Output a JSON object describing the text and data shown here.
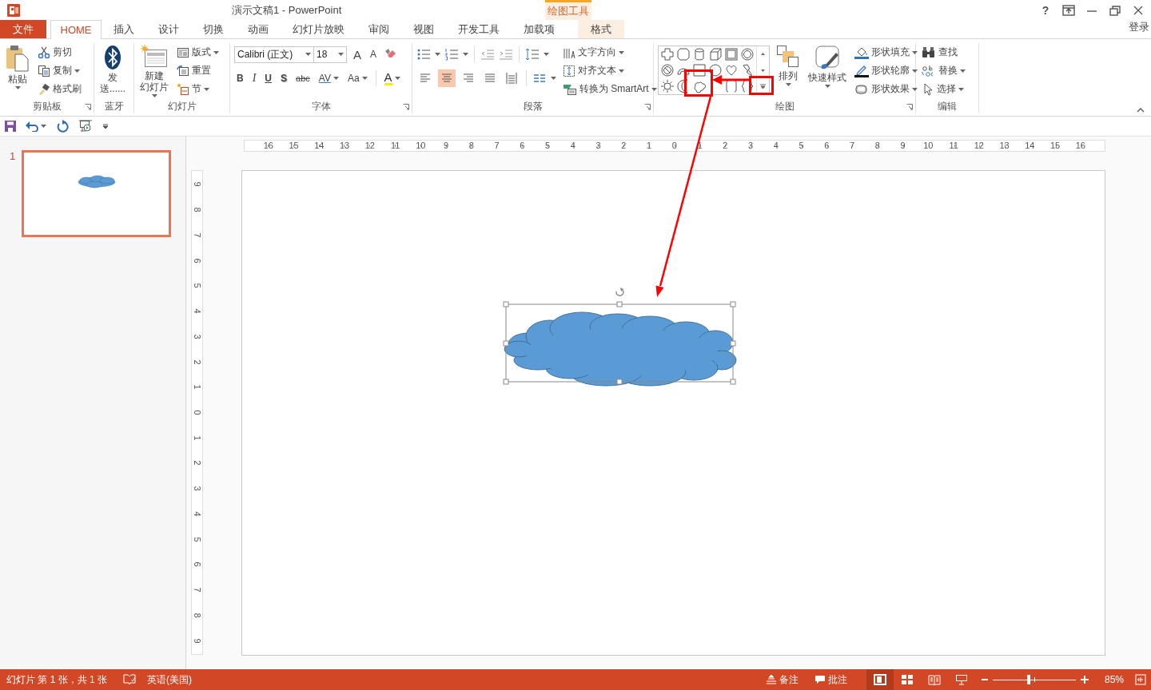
{
  "window": {
    "title": "演示文稿1 - PowerPoint",
    "help": "?",
    "context_group": "绘图工具",
    "sign_in": "登录"
  },
  "tabs": [
    {
      "label": "文件",
      "kind": "file",
      "selected": false
    },
    {
      "label": "HOME",
      "kind": "normal",
      "selected": true
    },
    {
      "label": "插入",
      "kind": "normal",
      "selected": false
    },
    {
      "label": "设计",
      "kind": "normal",
      "selected": false
    },
    {
      "label": "切换",
      "kind": "normal",
      "selected": false
    },
    {
      "label": "动画",
      "kind": "normal",
      "selected": false
    },
    {
      "label": "幻灯片放映",
      "kind": "normal",
      "selected": false
    },
    {
      "label": "审阅",
      "kind": "normal",
      "selected": false
    },
    {
      "label": "视图",
      "kind": "normal",
      "selected": false
    },
    {
      "label": "开发工具",
      "kind": "normal",
      "selected": false
    },
    {
      "label": "加载项",
      "kind": "normal",
      "selected": false
    },
    {
      "label": "格式",
      "kind": "contextual",
      "selected": false
    }
  ],
  "ribbon": {
    "groups": [
      {
        "kind": "clipboard",
        "label": "剪贴板",
        "big": "粘贴",
        "items": [
          {
            "label": "剪切",
            "kind": "cut"
          },
          {
            "label": "复制",
            "kind": "copy"
          },
          {
            "label": "格式刷",
            "kind": "painter"
          }
        ]
      },
      {
        "kind": "bluetooth",
        "label": "蓝牙",
        "big": [
          "发",
          "送......"
        ]
      },
      {
        "kind": "slides",
        "label": "幻灯片",
        "big": [
          "新建",
          "幻灯片"
        ],
        "items": [
          {
            "label": "版式",
            "kind": "layout"
          },
          {
            "label": "重置",
            "kind": "reset"
          },
          {
            "label": "节",
            "kind": "section"
          }
        ]
      },
      {
        "kind": "font",
        "label": "字体",
        "font_name": "Calibri (正文)",
        "font_size": "18",
        "size_buttons": [
          {
            "label": "A",
            "kind": "grow"
          },
          {
            "label": "A",
            "kind": "shrink"
          }
        ],
        "format_buttons": [
          {
            "label": "B",
            "kind": "bold"
          },
          {
            "label": "I",
            "kind": "italic"
          },
          {
            "label": "U",
            "kind": "underline"
          },
          {
            "label": "S",
            "kind": "shadow"
          },
          {
            "label": "abc",
            "kind": "strike"
          },
          {
            "label": "AV",
            "kind": "spacing"
          },
          {
            "label": "Aa",
            "kind": "case"
          }
        ],
        "font_color": "A"
      },
      {
        "kind": "paragraph",
        "label": "段落",
        "alignments": [
          {
            "kind": "left",
            "selected": false
          },
          {
            "kind": "center",
            "selected": true
          },
          {
            "kind": "right",
            "selected": false
          },
          {
            "kind": "justify",
            "selected": false
          },
          {
            "kind": "distributed",
            "selected": false
          }
        ],
        "items": [
          {
            "label": "文字方向",
            "kind": "direction"
          },
          {
            "label": "对齐文本",
            "kind": "align"
          },
          {
            "label": "转换为 SmartArt",
            "kind": "smartart"
          }
        ]
      },
      {
        "kind": "drawing",
        "label": "绘图",
        "bigs": [
          {
            "label": "排列",
            "kind": "arrange"
          },
          {
            "label": "快速样式",
            "kind": "styles"
          }
        ],
        "items": [
          {
            "label": "形状填充",
            "kind": "fill"
          },
          {
            "label": "形状轮廓",
            "kind": "outline"
          },
          {
            "label": "形状效果",
            "kind": "effects"
          }
        ]
      },
      {
        "kind": "editing",
        "label": "编辑",
        "items": [
          {
            "label": "查找",
            "kind": "find"
          },
          {
            "label": "替换",
            "kind": "replace"
          },
          {
            "label": "选择",
            "kind": "select"
          }
        ]
      }
    ]
  },
  "slides": [
    {
      "number": "1",
      "selected": true
    }
  ],
  "rulers": {
    "horizontal": [
      "16",
      "15",
      "14",
      "13",
      "12",
      "11",
      "10",
      "9",
      "8",
      "7",
      "6",
      "5",
      "4",
      "3",
      "2",
      "1",
      "0",
      "1",
      "2",
      "3",
      "4",
      "5",
      "6",
      "7",
      "8",
      "9",
      "10",
      "11",
      "12",
      "13",
      "14",
      "15",
      "16"
    ],
    "vertical": [
      "9",
      "8",
      "7",
      "6",
      "5",
      "4",
      "3",
      "2",
      "1",
      "0",
      "1",
      "2",
      "3",
      "4",
      "5",
      "6",
      "7",
      "8",
      "9"
    ]
  },
  "status_bar": {
    "slide_info": "幻灯片 第 1 张，共 1 张",
    "language": "英语(美国)",
    "notes": "备注",
    "comments": "批注",
    "views": [
      {
        "kind": "normal",
        "selected": true
      },
      {
        "kind": "sorter",
        "selected": false
      },
      {
        "kind": "reading",
        "selected": false
      },
      {
        "kind": "slideshow",
        "selected": false
      }
    ],
    "zoom": {
      "level": 0.43,
      "reading": "85%"
    }
  }
}
